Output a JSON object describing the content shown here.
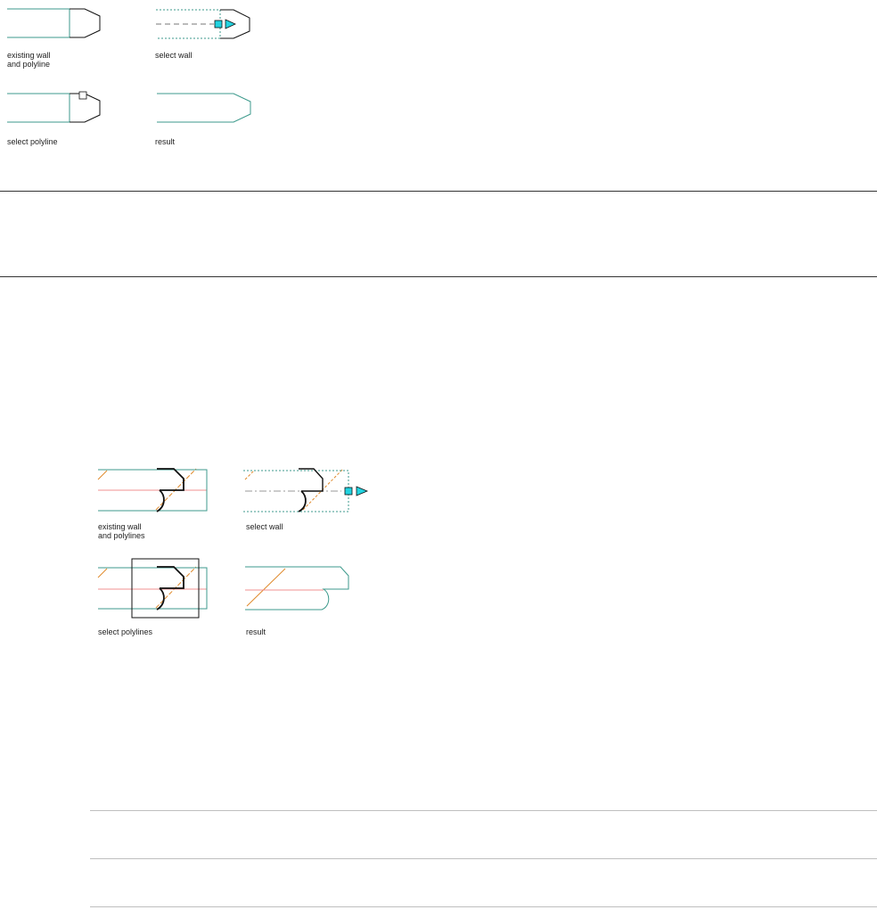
{
  "figure_1": {
    "labels": {
      "existing": "existing wall\nand polyline",
      "select_wall": "select wall",
      "select_polyline": "select polyline",
      "result": "result"
    }
  },
  "figure_2": {
    "labels": {
      "existing": "existing wall\nand polylines",
      "select_wall": "select wall",
      "select_polylines": "select polylines",
      "result": "result"
    }
  },
  "colors": {
    "wall": "#3d9a8c",
    "polyline": "#111111",
    "grip": "#22d3e0",
    "hatch": "#e08a2c",
    "baseline": "#f09090",
    "rule": "#333333",
    "rule_light": "#bfbfbf"
  }
}
